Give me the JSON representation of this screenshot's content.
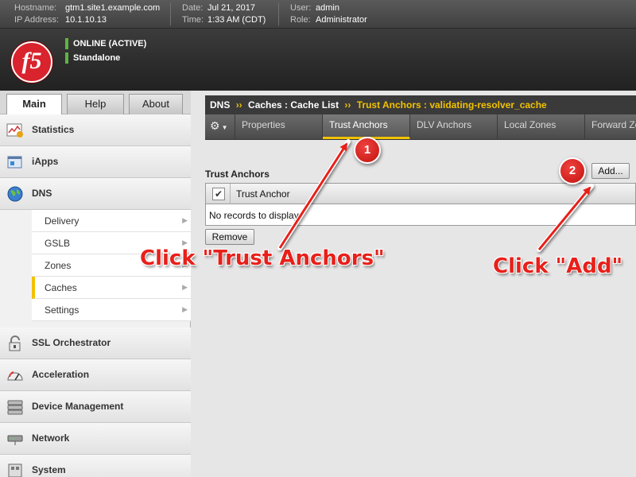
{
  "infobar": {
    "hostname_label": "Hostname:",
    "hostname": "gtm1.site1.example.com",
    "ip_label": "IP Address:",
    "ip": "10.1.10.13",
    "date_label": "Date:",
    "date": "Jul 21, 2017",
    "time_label": "Time:",
    "time": "1:33 AM (CDT)",
    "user_label": "User:",
    "user": "admin",
    "role_label": "Role:",
    "role": "Administrator"
  },
  "header": {
    "logo_text": "f5",
    "status_online": "ONLINE (ACTIVE)",
    "status_mode": "Standalone"
  },
  "main_tabs": [
    "Main",
    "Help",
    "About"
  ],
  "sidebar": {
    "items": [
      {
        "label": "Statistics",
        "icon": "statistics-icon"
      },
      {
        "label": "iApps",
        "icon": "iapps-icon"
      },
      {
        "label": "DNS",
        "icon": "globe-icon"
      },
      {
        "label": "SSL Orchestrator",
        "icon": "padlock-icon"
      },
      {
        "label": "Acceleration",
        "icon": "gauge-icon"
      },
      {
        "label": "Device Management",
        "icon": "server-icon"
      },
      {
        "label": "Network",
        "icon": "network-icon"
      },
      {
        "label": "System",
        "icon": "system-icon"
      }
    ],
    "dns_submenu": [
      "Delivery",
      "GSLB",
      "Zones",
      "Caches",
      "Settings"
    ]
  },
  "breadcrumb": {
    "section": "DNS",
    "sep": "››",
    "parent": "Caches : Cache List",
    "current": "Trust Anchors : validating-resolver_cache"
  },
  "subtabs": [
    "Properties",
    "Trust Anchors",
    "DLV Anchors",
    "Local Zones",
    "Forward Zones"
  ],
  "content": {
    "section_title": "Trust Anchors",
    "add_label": "Add...",
    "column_header": "Trust Anchor",
    "checkbox_mark": "✔",
    "empty_message": "No records to display.",
    "remove_label": "Remove"
  },
  "annotations": {
    "badge_1": "1",
    "badge_2": "2",
    "callout_1": "Click \"Trust Anchors\"",
    "callout_2": "Click \"Add\"",
    "color": "#e8201a"
  },
  "colors": {
    "accent": "#f2c200",
    "brand": "#d9232d",
    "status_ok": "#5db542"
  }
}
